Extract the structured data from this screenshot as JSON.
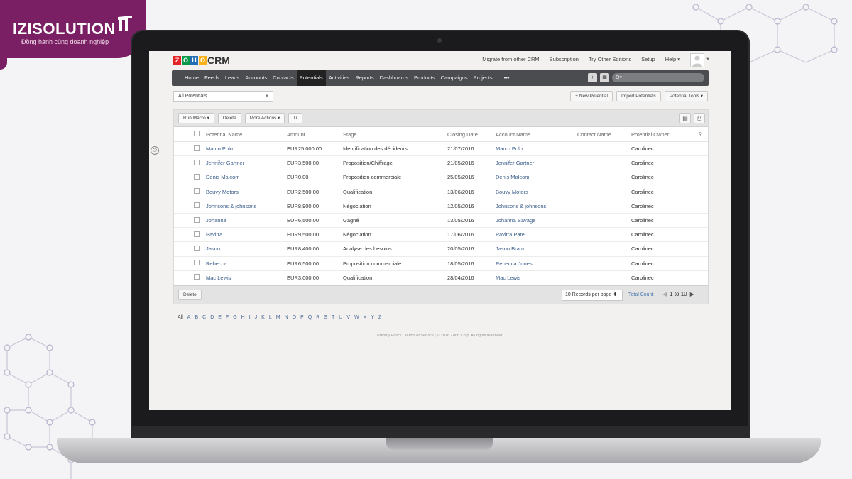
{
  "brand": {
    "name": "IZISOLUTION",
    "tagline": "Đồng hành cùng doanh nghiệp",
    "color": "#7a1f63"
  },
  "crm": {
    "logo_letters": [
      "Z",
      "O",
      "H",
      "O"
    ],
    "logo_colors": [
      "#e42527",
      "#089949",
      "#226db4",
      "#f9b21d"
    ],
    "app_name": "CRM",
    "top_links": [
      "Migrate from other CRM",
      "Subscription",
      "Try Other Editions",
      "Setup",
      "Help ▾"
    ],
    "nav": [
      "Home",
      "Feeds",
      "Leads",
      "Accounts",
      "Contacts",
      "Potentials",
      "Activities",
      "Reports",
      "Dashboards",
      "Products",
      "Campaigns",
      "Projects",
      "•••"
    ],
    "active_nav": "Potentials",
    "search_placeholder": "Q▾",
    "view_select": "All Potentials",
    "actions": {
      "new": "+ New Potential",
      "import": "Import Potentials",
      "tools": "Potential Tools ▾"
    },
    "toolbar": {
      "run_macro": "Run Macro ▾",
      "delete": "Delete",
      "more": "More Actions ▾",
      "refresh": "↻"
    },
    "columns": [
      "Potential Name",
      "Amount",
      "Stage",
      "Closing Date",
      "Account Name",
      "Contact Name",
      "Potential Owner"
    ],
    "rows": [
      {
        "name": "Marco Polo",
        "amount": "EUR25,000.00",
        "stage": "Identification des décideurs",
        "date": "21/07/2016",
        "account": "Marco Polo",
        "contact": "",
        "owner": "Carolinec"
      },
      {
        "name": "Jennifer Gartner",
        "amount": "EUR3,500.00",
        "stage": "Proposition/Chiffrage",
        "date": "21/05/2016",
        "account": "Jennifer Gartner",
        "contact": "",
        "owner": "Carolinec"
      },
      {
        "name": "Denis Malcom",
        "amount": "EUR0.00",
        "stage": "Proposition commerciale",
        "date": "25/05/2016",
        "account": "Denis Malcom",
        "contact": "",
        "owner": "Carolinec"
      },
      {
        "name": "Bouvy Motors",
        "amount": "EUR2,500.00",
        "stage": "Qualification",
        "date": "13/06/2016",
        "account": "Bouvy Motors",
        "contact": "",
        "owner": "Carolinec"
      },
      {
        "name": "Johnsons & johnsons",
        "amount": "EUR8,900.00",
        "stage": "Négociation",
        "date": "12/05/2016",
        "account": "Johnsons & johnsons",
        "contact": "",
        "owner": "Carolinec"
      },
      {
        "name": "Johanna",
        "amount": "EUR6,500.00",
        "stage": "Gagné",
        "date": "13/05/2016",
        "account": "Johanna Savage",
        "contact": "",
        "owner": "Carolinec"
      },
      {
        "name": "Pavitra",
        "amount": "EUR9,500.00",
        "stage": "Négociation",
        "date": "17/06/2016",
        "account": "Pavitra Patel",
        "contact": "",
        "owner": "Carolinec"
      },
      {
        "name": "Jason",
        "amount": "EUR8,400.00",
        "stage": "Analyse des besoins",
        "date": "20/05/2016",
        "account": "Jason Bram",
        "contact": "",
        "owner": "Carolinec"
      },
      {
        "name": "Rebecca",
        "amount": "EUR6,500.00",
        "stage": "Proposition commerciale",
        "date": "18/05/2016",
        "account": "Rebecca Jones",
        "contact": "",
        "owner": "Carolinec"
      },
      {
        "name": "Mac Lewis",
        "amount": "EUR3,000.00",
        "stage": "Qualification",
        "date": "28/04/2016",
        "account": "Mac Lewis",
        "contact": "",
        "owner": "Carolinec"
      }
    ],
    "footer": {
      "delete": "Delete",
      "per_page": "10 Records per page ⬍",
      "total_count": "Total Count",
      "range": "1 to 10"
    },
    "alphabet": [
      "All",
      "A",
      "B",
      "C",
      "D",
      "E",
      "F",
      "G",
      "H",
      "I",
      "J",
      "K",
      "L",
      "M",
      "N",
      "O",
      "P",
      "Q",
      "R",
      "S",
      "T",
      "U",
      "V",
      "W",
      "X",
      "Y",
      "Z"
    ],
    "copyright": "Privacy Policy | Terms of Service | © 2016 Zoho Corp. All rights reserved."
  }
}
